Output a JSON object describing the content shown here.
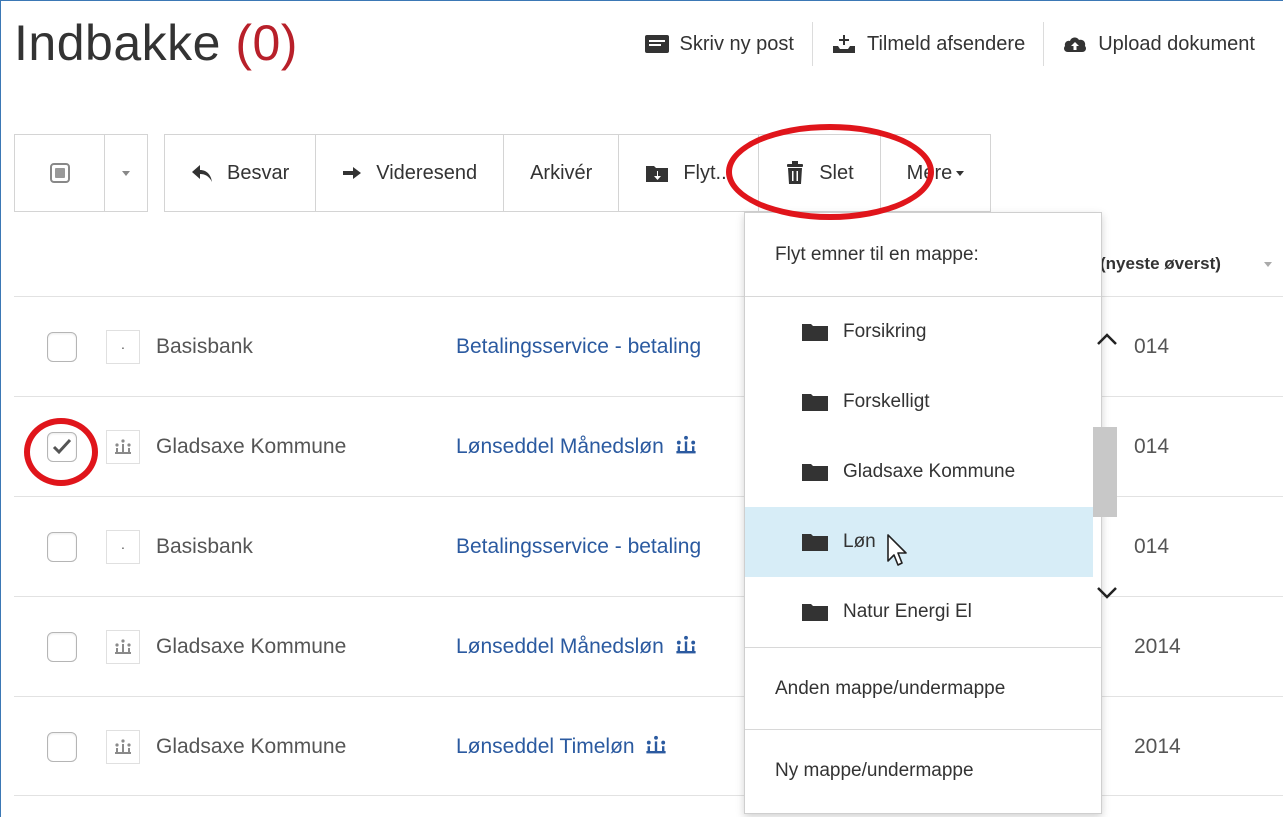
{
  "header": {
    "title": "Indbakke",
    "count": "(0)"
  },
  "top_actions": [
    {
      "label": "Skriv ny post",
      "icon": "compose-icon"
    },
    {
      "label": "Tilmeld afsendere",
      "icon": "subscribe-icon"
    },
    {
      "label": "Upload dokument",
      "icon": "cloud-upload-icon"
    }
  ],
  "toolbar": {
    "reply": "Besvar",
    "forward": "Videresend",
    "archive": "Arkivér",
    "move": "Flyt...",
    "delete": "Slet",
    "more": "Mere"
  },
  "list": {
    "sort_label": "(nyeste øverst)",
    "rows": [
      {
        "sender": "Basisbank",
        "subject": "Betalingsservice - betaling",
        "date": "014",
        "checked": false,
        "avatar": "dot"
      },
      {
        "sender": "Gladsaxe Kommune",
        "subject": "Lønseddel Månedsløn",
        "date": "014",
        "checked": true,
        "avatar": "crown"
      },
      {
        "sender": "Basisbank",
        "subject": "Betalingsservice - betaling",
        "date": "014",
        "checked": false,
        "avatar": "dot"
      },
      {
        "sender": "Gladsaxe Kommune",
        "subject": "Lønseddel Månedsløn",
        "date": "2014",
        "checked": false,
        "avatar": "crown"
      },
      {
        "sender": "Gladsaxe Kommune",
        "subject": "Lønseddel Timeløn",
        "date": "2014",
        "checked": false,
        "avatar": "crown"
      }
    ]
  },
  "move_dropdown": {
    "header": "Flyt emner til en mappe:",
    "folders": [
      "Forsikring",
      "Forskelligt",
      "Gladsaxe Kommune",
      "Løn",
      "Natur Energi El"
    ],
    "hovered": "Løn",
    "other_folder": "Anden mappe/undermappe",
    "new_folder": "Ny mappe/undermappe"
  },
  "colors": {
    "accent_red": "#b8202a",
    "annotation_red": "#e0151b",
    "link_blue": "#2b5aa0",
    "hover_blue": "#d7edf7"
  }
}
